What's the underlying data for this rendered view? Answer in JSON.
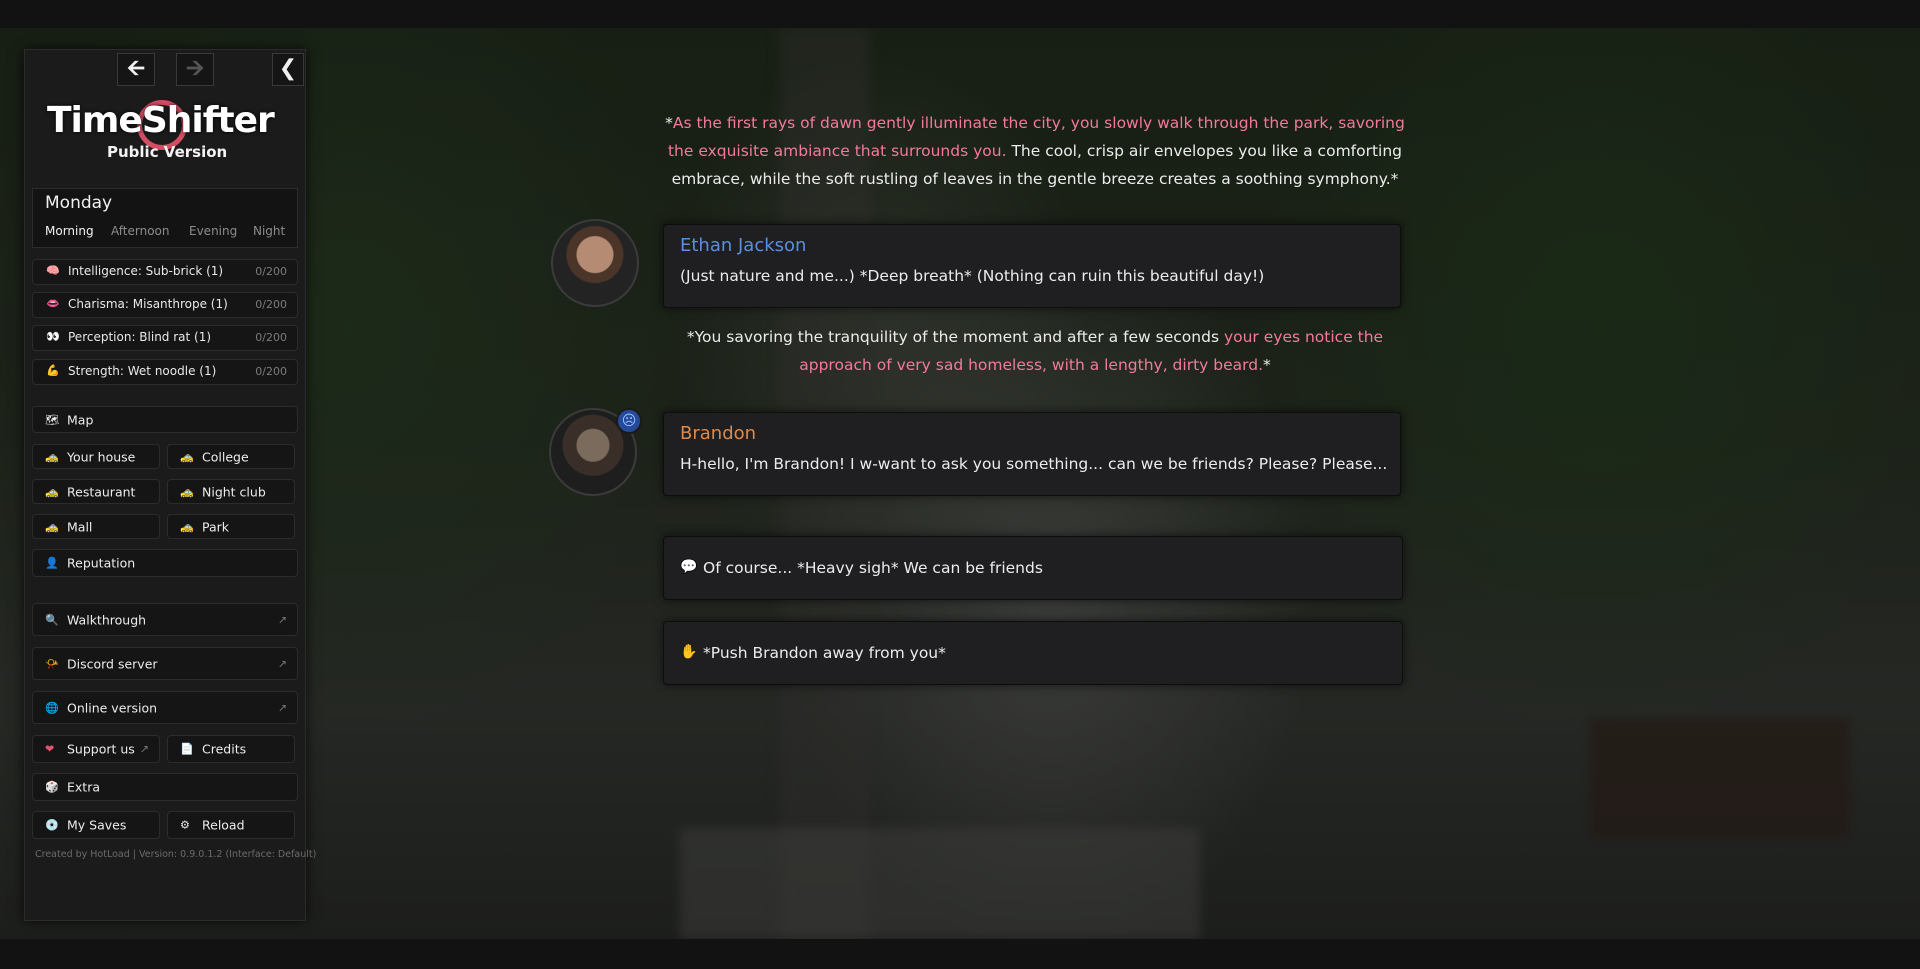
{
  "nav": {
    "back_icon": "arrow-left-icon",
    "forward_icon": "arrow-right-icon",
    "collapse_icon": "chevron-left-icon"
  },
  "logo": {
    "title": "TimeShifter",
    "subtitle": "Public Version",
    "accent": "#e8536d"
  },
  "calendar": {
    "day": "Monday",
    "times": [
      "Morning",
      "Afternoon",
      "Evening",
      "Night"
    ],
    "active_time": "Morning"
  },
  "stats": [
    {
      "icon": "brain-icon",
      "label": "Intelligence: Sub-brick (1)",
      "value": "0/200"
    },
    {
      "icon": "lips-icon",
      "label": "Charisma: Misanthrope (1)",
      "value": "0/200"
    },
    {
      "icon": "eyes-icon",
      "label": "Perception: Blind rat (1)",
      "value": "0/200"
    },
    {
      "icon": "flexed-arm-icon",
      "label": "Strength: Wet noodle (1)",
      "value": "0/200"
    }
  ],
  "map": {
    "label": "Map",
    "icon": "map-icon"
  },
  "locations": [
    {
      "label": "Your house",
      "icon": "taxi-icon"
    },
    {
      "label": "College",
      "icon": "taxi-icon"
    },
    {
      "label": "Restaurant",
      "icon": "taxi-icon"
    },
    {
      "label": "Night club",
      "icon": "taxi-icon"
    },
    {
      "label": "Mall",
      "icon": "taxi-icon"
    },
    {
      "label": "Park",
      "icon": "taxi-icon"
    }
  ],
  "reputation": {
    "label": "Reputation",
    "icon": "person-icon"
  },
  "links": [
    {
      "label": "Walkthrough",
      "icon": "magnifier-icon"
    },
    {
      "label": "Discord server",
      "icon": "horn-icon"
    },
    {
      "label": "Online version",
      "icon": "globe-icon"
    }
  ],
  "support": {
    "label": "Support us",
    "icon": "heart-icon"
  },
  "credits": {
    "label": "Credits",
    "icon": "document-icon"
  },
  "extra": {
    "label": "Extra",
    "icon": "dice-icon"
  },
  "saves": {
    "label": "My Saves",
    "icon": "disc-icon"
  },
  "reload": {
    "label": "Reload",
    "icon": "gear-icon"
  },
  "footer": "Created by HotLoad | Version: 0.9.0.1.2 (Interface: Default)",
  "story": {
    "narration1": {
      "open": "*",
      "pink": "As the first rays of dawn gently illuminate the city, you slowly walk through the park, savoring the exquisite ambiance that surrounds you.",
      "plain": " The cool, crisp air envelopes you like a comforting embrace, while the soft rustling of leaves in the gentle breeze creates a soothing symphony.*"
    },
    "ethan": {
      "name": "Ethan Jackson",
      "name_color": "#5b8fe0",
      "text": "(Just nature and me...) *Deep breath* (Nothing can ruin this beautiful day!)"
    },
    "narration2": {
      "plain": "*You savoring the tranquility of the moment and after a few seconds ",
      "pink": "your eyes notice the approach of very sad homeless, with a lengthy, dirty beard.",
      "close": "*"
    },
    "brandon": {
      "name": "Brandon",
      "name_color": "#e08a4a",
      "mood_icon": "sad-face-icon",
      "text": "H-hello, I'm Brandon! I w-want to ask you something... can we be friends? Please? Please..."
    },
    "choices": [
      {
        "icon": "speech-bubble-icon",
        "text": "Of course... *Heavy sigh* We can be friends"
      },
      {
        "icon": "raised-hand-icon",
        "text": "*Push Brandon away from you*"
      }
    ]
  }
}
